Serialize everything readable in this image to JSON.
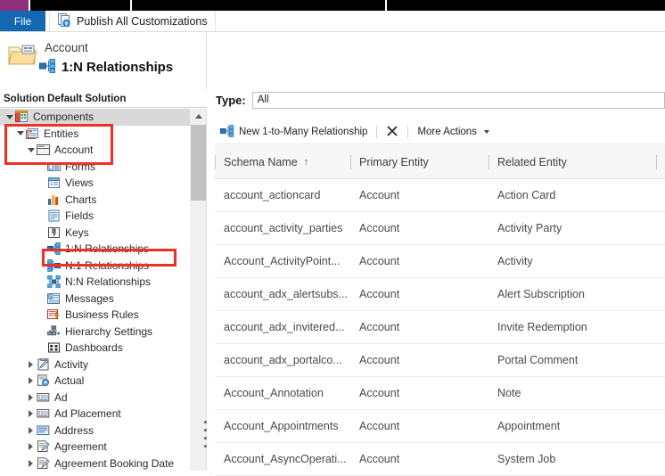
{
  "window": {
    "accent_purple": "#8e2f7a",
    "file_tab_blue": "#1268b3",
    "annotation_red": "#ee3124"
  },
  "ribbon": {
    "file_tab": "File",
    "publish_label": "Publish All Customizations",
    "publish_icon": "publish-icon"
  },
  "header": {
    "entity": "Account",
    "title": "1:N Relationships",
    "folder_icon": "folder-icon",
    "title_icon": "one-to-many-icon",
    "solution_label": "Solution Default Solution"
  },
  "tree": {
    "scroll_up_icon": "scroll-up-arrow-icon",
    "items": [
      {
        "label": "Components",
        "indent": 0,
        "icon": "components-icon",
        "twisty": "open",
        "selected": true
      },
      {
        "label": "Entities",
        "indent": 1,
        "icon": "entities-icon",
        "twisty": "open",
        "selected": false
      },
      {
        "label": "Account",
        "indent": 2,
        "icon": "entity-icon",
        "twisty": "open",
        "selected": false
      },
      {
        "label": "Forms",
        "indent": 3,
        "icon": "forms-icon",
        "twisty": "none",
        "selected": false
      },
      {
        "label": "Views",
        "indent": 3,
        "icon": "views-icon",
        "twisty": "none",
        "selected": false
      },
      {
        "label": "Charts",
        "indent": 3,
        "icon": "charts-icon",
        "twisty": "none",
        "selected": false
      },
      {
        "label": "Fields",
        "indent": 3,
        "icon": "fields-icon",
        "twisty": "none",
        "selected": false
      },
      {
        "label": "Keys",
        "indent": 3,
        "icon": "keys-icon",
        "twisty": "none",
        "selected": false
      },
      {
        "label": "1:N Relationships",
        "indent": 3,
        "icon": "one-to-many-icon",
        "twisty": "none",
        "selected": false
      },
      {
        "label": "N:1 Relationships",
        "indent": 3,
        "icon": "many-to-one-icon",
        "twisty": "none",
        "selected": false
      },
      {
        "label": "N:N Relationships",
        "indent": 3,
        "icon": "many-to-many-icon",
        "twisty": "none",
        "selected": false
      },
      {
        "label": "Messages",
        "indent": 3,
        "icon": "messages-icon",
        "twisty": "none",
        "selected": false
      },
      {
        "label": "Business Rules",
        "indent": 3,
        "icon": "business-rules-icon",
        "twisty": "none",
        "selected": false
      },
      {
        "label": "Hierarchy Settings",
        "indent": 3,
        "icon": "hierarchy-icon",
        "twisty": "none",
        "selected": false
      },
      {
        "label": "Dashboards",
        "indent": 3,
        "icon": "dashboards-icon",
        "twisty": "none",
        "selected": false
      },
      {
        "label": "Activity",
        "indent": 2,
        "icon": "activity-icon",
        "twisty": "closed",
        "selected": false
      },
      {
        "label": "Actual",
        "indent": 2,
        "icon": "actual-icon",
        "twisty": "closed",
        "selected": false
      },
      {
        "label": "Ad",
        "indent": 2,
        "icon": "ad-icon",
        "twisty": "closed",
        "selected": false
      },
      {
        "label": "Ad Placement",
        "indent": 2,
        "icon": "ad-icon",
        "twisty": "closed",
        "selected": false
      },
      {
        "label": "Address",
        "indent": 2,
        "icon": "address-icon",
        "twisty": "closed",
        "selected": false
      },
      {
        "label": "Agreement",
        "indent": 2,
        "icon": "agreement-icon",
        "twisty": "closed",
        "selected": false
      },
      {
        "label": "Agreement Booking Date",
        "indent": 2,
        "icon": "agreement-icon",
        "twisty": "closed",
        "selected": false
      }
    ]
  },
  "filter": {
    "type_label": "Type:",
    "type_value": "All"
  },
  "toolbar": {
    "new_label": "New 1-to-Many Relationship",
    "new_icon": "one-to-many-icon",
    "delete_icon": "delete-x-icon",
    "more_actions_label": "More Actions",
    "more_actions_caret": "chevron-down-icon"
  },
  "grid": {
    "columns": [
      {
        "label": "Schema Name",
        "sort": "↑"
      },
      {
        "label": "Primary Entity",
        "sort": ""
      },
      {
        "label": "Related Entity",
        "sort": ""
      }
    ],
    "rows": [
      {
        "schema": "account_actioncard",
        "primary": "Account",
        "related": "Action Card"
      },
      {
        "schema": "account_activity_parties",
        "primary": "Account",
        "related": "Activity Party"
      },
      {
        "schema": "Account_ActivityPoint...",
        "primary": "Account",
        "related": "Activity"
      },
      {
        "schema": "account_adx_alertsubs...",
        "primary": "Account",
        "related": "Alert Subscription"
      },
      {
        "schema": "account_adx_invitered...",
        "primary": "Account",
        "related": "Invite Redemption"
      },
      {
        "schema": "account_adx_portalco...",
        "primary": "Account",
        "related": "Portal Comment"
      },
      {
        "schema": "Account_Annotation",
        "primary": "Account",
        "related": "Note"
      },
      {
        "schema": "Account_Appointments",
        "primary": "Account",
        "related": "Appointment"
      },
      {
        "schema": "Account_AsyncOperati...",
        "primary": "Account",
        "related": "System Job"
      }
    ]
  },
  "annotations": [
    {
      "name": "highlight-components-entities-account"
    },
    {
      "name": "highlight-one-to-many-relationships"
    }
  ]
}
